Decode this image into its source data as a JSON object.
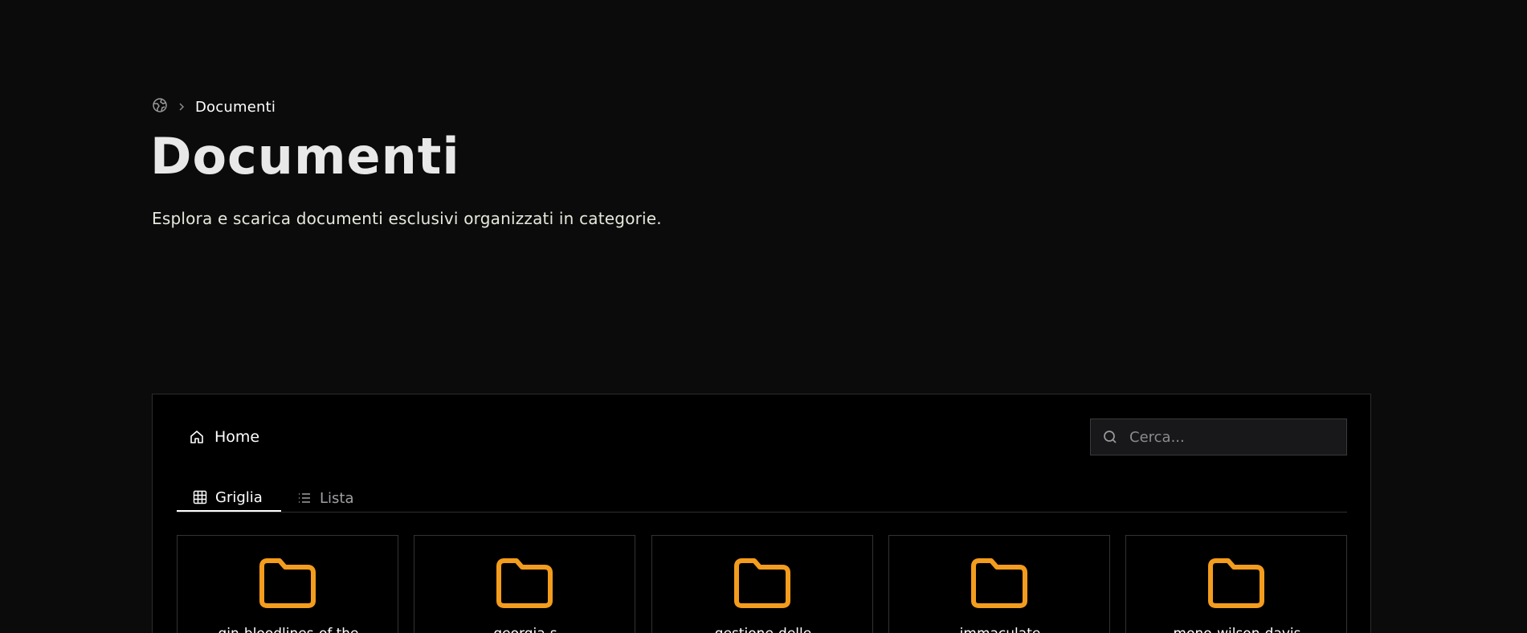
{
  "breadcrumb": {
    "home_icon": "globe-icon",
    "separator_icon": "chevron-right-icon",
    "current": "Documenti"
  },
  "header": {
    "title": "Documenti",
    "subtitle": "Esplora e scarica documenti esclusivi organizzati in categorie."
  },
  "browser": {
    "home_label": "Home",
    "home_icon": "home-icon",
    "search": {
      "placeholder": "Cerca...",
      "value": ""
    },
    "tabs": [
      {
        "label": "Griglia",
        "icon": "grid-icon",
        "active": true
      },
      {
        "label": "Lista",
        "icon": "list-icon",
        "active": false
      }
    ],
    "folders": [
      {
        "name": "gin-bloodlines-of-the"
      },
      {
        "name": "georgia-s"
      },
      {
        "name": "gestione-delle"
      },
      {
        "name": "immaculate"
      },
      {
        "name": "mono-wilson-davis"
      }
    ]
  },
  "colors": {
    "background": "#0b0b0c",
    "panel": "#000000",
    "accent_folder": "#f39c1d",
    "text": "#ffffff"
  }
}
